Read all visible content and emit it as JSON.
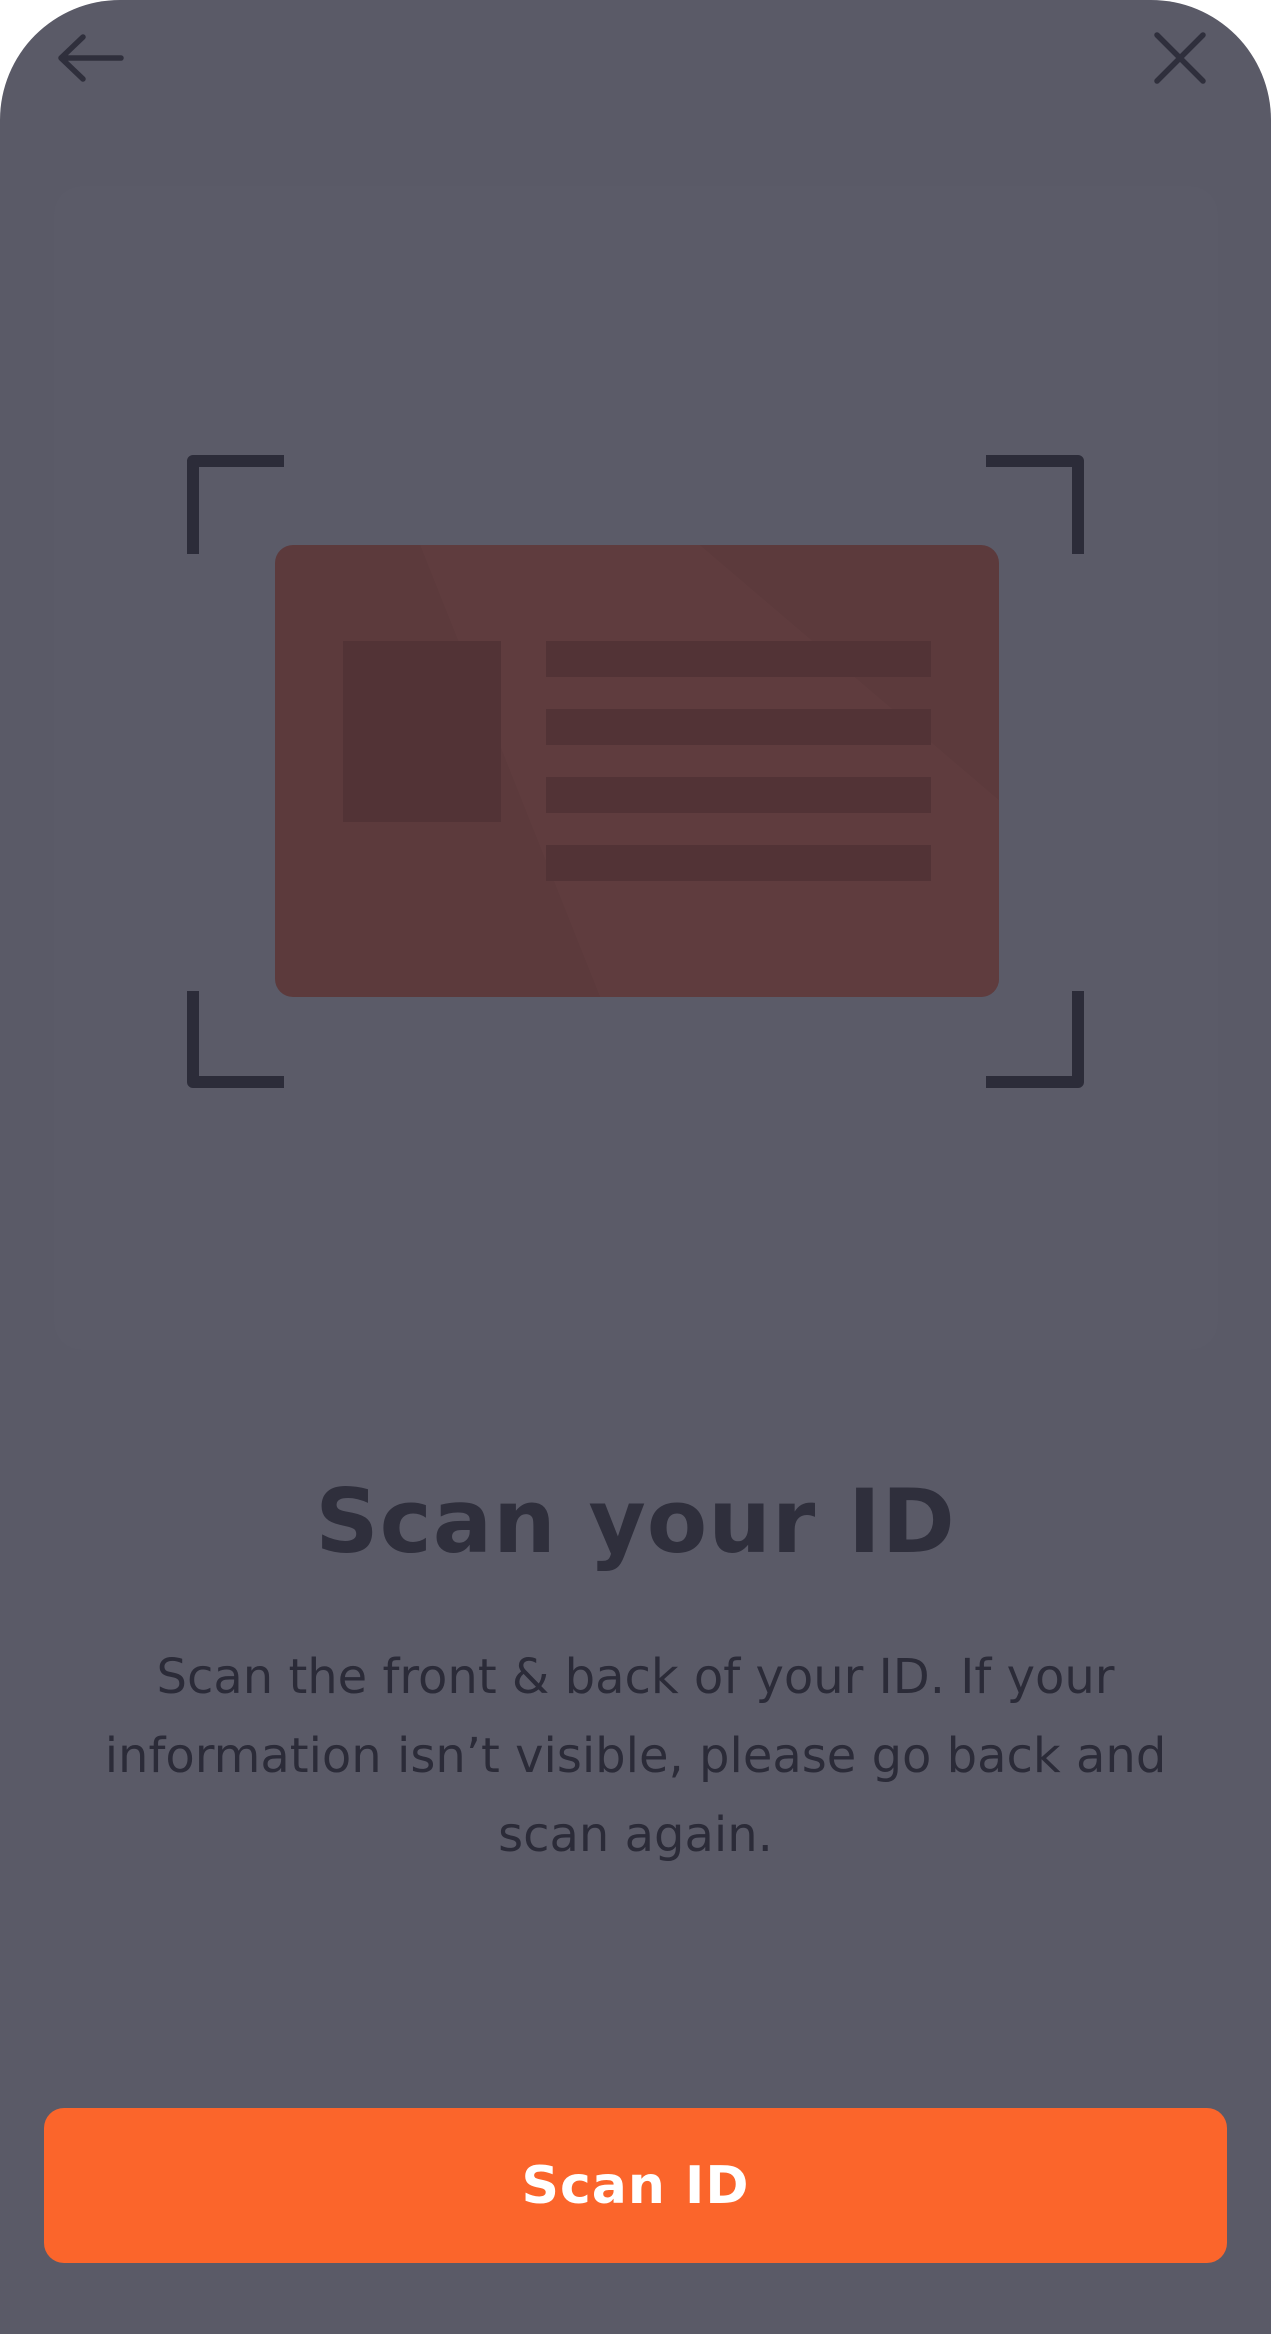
{
  "header": {
    "back_icon": "arrow-left-icon",
    "close_icon": "close-icon"
  },
  "illustration": {
    "icon": "id-card-icon",
    "card_color": "#5c3a3c"
  },
  "content": {
    "title": "Scan your ID",
    "description": "Scan the front & back of your ID. If your information isn’t visible, please go back and scan again."
  },
  "actions": {
    "primary_label": "Scan ID",
    "primary_color": "#fb652b"
  },
  "colors": {
    "background": "#5a5a67",
    "text_dark": "#2f2f3c"
  }
}
